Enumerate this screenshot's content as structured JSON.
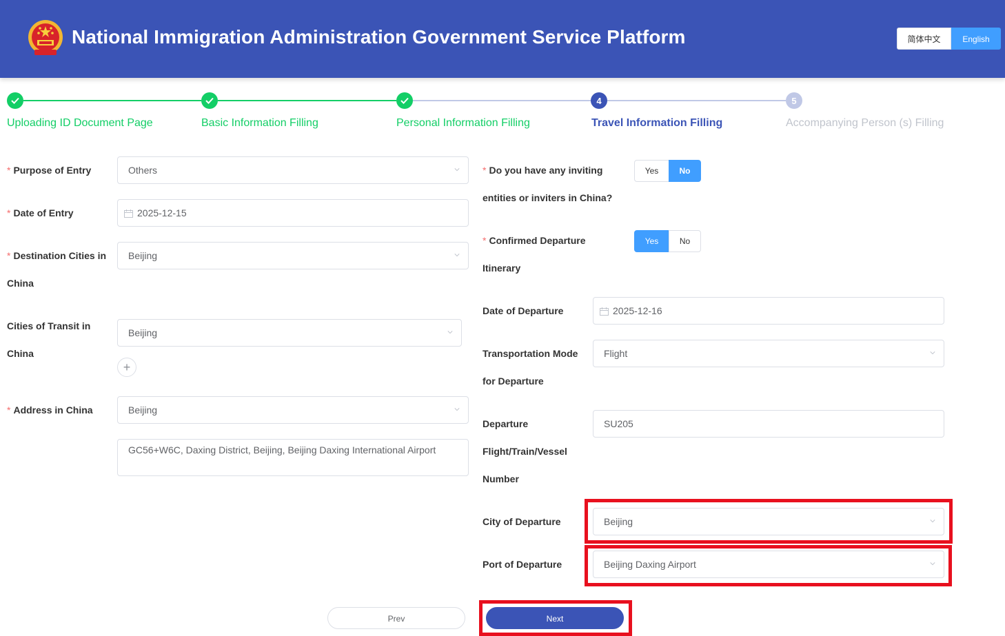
{
  "header": {
    "title": "National Immigration Administration Government Service Platform",
    "lang_zh": "简体中文",
    "lang_en": "English",
    "bg_color": "#3b54b6"
  },
  "steps": [
    {
      "num": "",
      "label": "Uploading ID Document Page",
      "state": "done"
    },
    {
      "num": "",
      "label": "Basic Information Filling",
      "state": "done"
    },
    {
      "num": "",
      "label": "Personal Information Filling",
      "state": "done"
    },
    {
      "num": "4",
      "label": "Travel Information Filling",
      "state": "active"
    },
    {
      "num": "5",
      "label": "Accompanying Person (s) Filling",
      "state": "wait"
    }
  ],
  "left": {
    "purpose": {
      "label": "Purpose of Entry",
      "value": "Others"
    },
    "entry_date": {
      "label": "Date of Entry",
      "value": "2025-12-15"
    },
    "destination": {
      "label_1": "Destination Cities in",
      "label_2": "China",
      "value": "Beijing"
    },
    "transit": {
      "label_1": "Cities of Transit in",
      "label_2": "China",
      "value": "Beijing",
      "add": "+"
    },
    "address": {
      "label": "Address in China",
      "value": "Beijing",
      "detail": "GC56+W6C, Daxing District, Beijing, Beijing Daxing International Airport"
    }
  },
  "right": {
    "inviting": {
      "label_1": "Do you have any inviting",
      "label_2": "entities or inviters in China?",
      "yes": "Yes",
      "no": "No",
      "selected": "No"
    },
    "confirmed": {
      "label_1": "Confirmed Departure",
      "label_2": "Itinerary",
      "yes": "Yes",
      "no": "No",
      "selected": "Yes"
    },
    "departure_date": {
      "label": "Date of Departure",
      "value": "2025-12-16"
    },
    "transport": {
      "label_1": "Transportation Mode",
      "label_2": "for Departure",
      "value": "Flight"
    },
    "number": {
      "label_1": "Departure",
      "label_2": "Flight/Train/Vessel",
      "label_3": "Number",
      "value": "SU205"
    },
    "city": {
      "label": "City of Departure",
      "value": "Beijing"
    },
    "port": {
      "label": "Port of Departure",
      "value": "Beijing Daxing Airport"
    }
  },
  "buttons": {
    "prev": "Prev",
    "next": "Next"
  },
  "colors": {
    "success": "#13ce66",
    "primary": "#409eff",
    "highlight": "#e8101e"
  }
}
